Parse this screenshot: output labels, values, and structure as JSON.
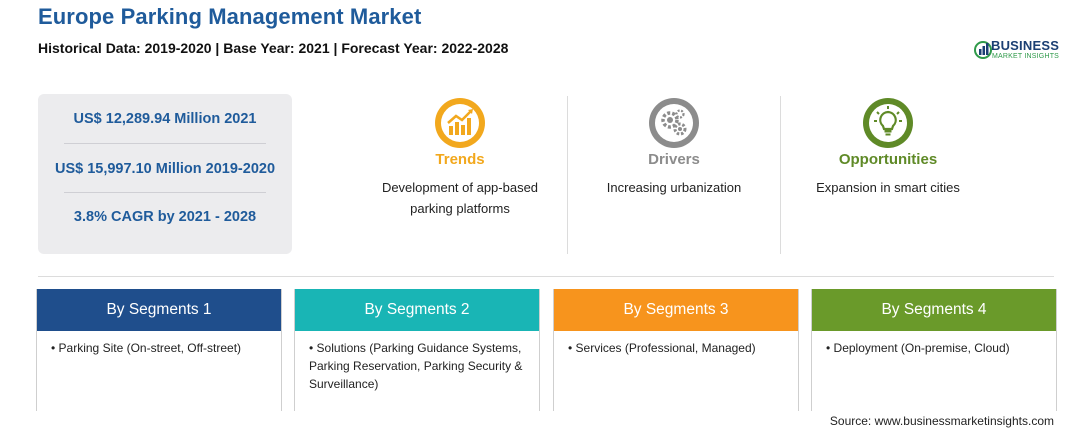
{
  "header": {
    "title": "Europe Parking Management Market",
    "subtitle": "Historical Data: 2019-2020 | Base Year: 2021 | Forecast Year: 2022-2028"
  },
  "logo": {
    "name": "BUSINESS",
    "tagline": "MARKET INSIGHTS"
  },
  "stats": [
    "US$ 12,289.94 Million 2021",
    "US$ 15,997.10 Million 2019-2020",
    "3.8% CAGR by 2021 - 2028"
  ],
  "features": [
    {
      "label": "Trends",
      "description": "Development of app-based parking platforms",
      "color": "#f2a81d",
      "icon": "trend-chart-icon"
    },
    {
      "label": "Drivers",
      "description": "Increasing urbanization",
      "color": "#8c8c8c",
      "icon": "gears-icon"
    },
    {
      "label": "Opportunities",
      "description": "Expansion in smart cities",
      "color": "#5f8a27",
      "icon": "lightbulb-icon"
    }
  ],
  "segments": [
    {
      "title": "By Segments 1",
      "color": "#1f4e8c",
      "items": [
        "Parking Site (On-street, Off-street)"
      ]
    },
    {
      "title": "By Segments 2",
      "color": "#19b5b5",
      "items": [
        "Solutions (Parking Guidance Systems, Parking Reservation, Parking Security & Surveillance)"
      ]
    },
    {
      "title": "By Segments 3",
      "color": "#f7941d",
      "items": [
        "Services (Professional, Managed)"
      ]
    },
    {
      "title": "By Segments 4",
      "color": "#6a9a2a",
      "items": [
        "Deployment (On-premise, Cloud)"
      ]
    }
  ],
  "footer": {
    "source": "Source: www.businessmarketinsights.com"
  }
}
